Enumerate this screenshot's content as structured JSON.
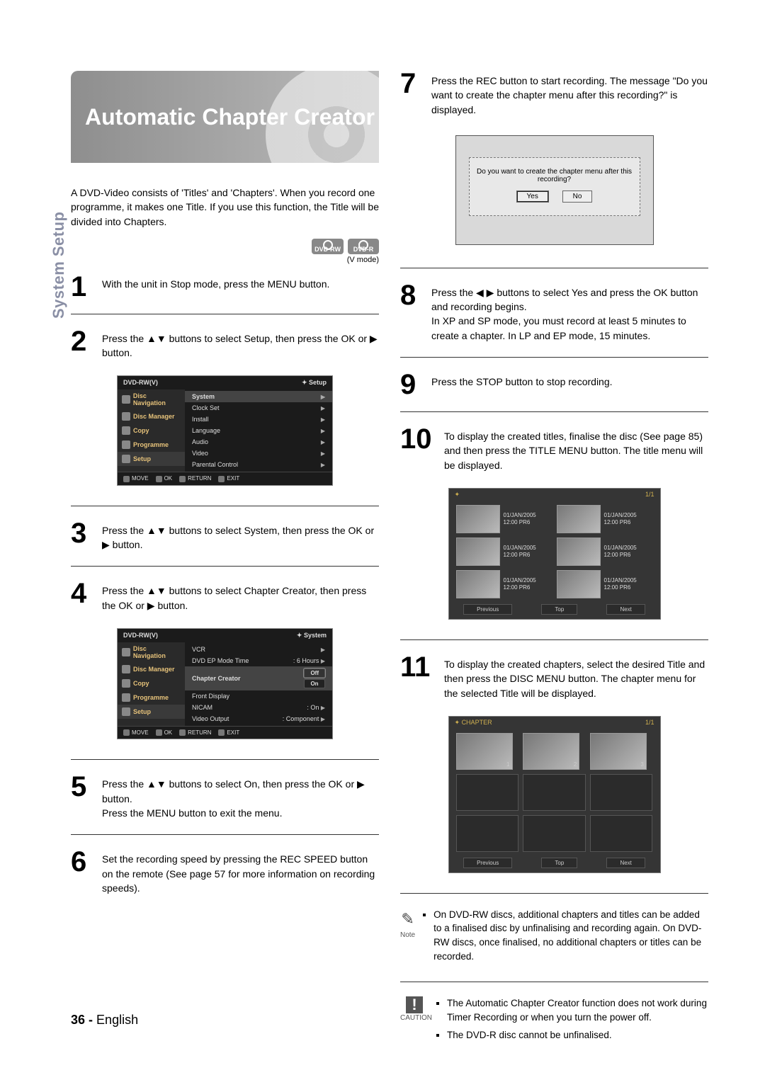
{
  "side_tab": "System Setup",
  "title": "Automatic Chapter Creator",
  "intro": "A DVD-Video consists of 'Titles' and 'Chapters'. When you record one programme, it makes one Title. If you use this function, the Title will be divided into Chapters.",
  "badges": {
    "rw": "DVD-RW",
    "r": "DVD-R",
    "vmode": "(V mode)"
  },
  "steps": {
    "s1": "With the unit in Stop mode, press the MENU button.",
    "s2": "Press the ▲▼ buttons to select Setup, then press the OK or ▶ button.",
    "s3": "Press the ▲▼ buttons to select System, then press the OK or ▶ button.",
    "s4": "Press the ▲▼ buttons to select Chapter Creator, then press the OK or ▶ button.",
    "s5": "Press the ▲▼ buttons to select On, then press the OK or ▶ button.\nPress the MENU button to exit the menu.",
    "s6": "Set the recording speed by pressing the REC SPEED button on the remote (See page 57 for more information on recording speeds).",
    "s7": "Press the REC button to start recording. The message \"Do you want to create the chapter menu after this recording?\" is displayed.",
    "s8": "Press the ◀ ▶ buttons to select Yes and press the OK button and recording begins.\nIn XP and SP mode, you must record at least 5 minutes to create a chapter. In LP and EP mode, 15 minutes.",
    "s9": "Press the STOP button to stop recording.",
    "s10": "To display the created titles, finalise the disc (See page 85) and then press the TITLE MENU button. The title menu will be displayed.",
    "s11": "To display the created chapters, select the desired Title and then press the DISC MENU button. The chapter menu for the selected Title will be displayed."
  },
  "osd1": {
    "hdr_l": "DVD-RW(V)",
    "hdr_r": "Setup",
    "nav": [
      "Disc Navigation",
      "Disc Manager",
      "Copy",
      "Programme",
      "Setup"
    ],
    "list": [
      "System",
      "Clock Set",
      "Install",
      "Language",
      "Audio",
      "Video",
      "Parental Control"
    ],
    "ftr": [
      "MOVE",
      "OK",
      "RETURN",
      "EXIT"
    ]
  },
  "osd2": {
    "hdr_l": "DVD-RW(V)",
    "hdr_r": "System",
    "nav": [
      "Disc Navigation",
      "Disc Manager",
      "Copy",
      "Programme",
      "Setup"
    ],
    "rows": [
      {
        "l": "VCR",
        "r": ""
      },
      {
        "l": "DVD EP Mode Time",
        "r": ": 6 Hours"
      },
      {
        "l": "Chapter Creator",
        "r": "",
        "opts": [
          "Off",
          "On"
        ]
      },
      {
        "l": "Front Display",
        "r": ""
      },
      {
        "l": "NICAM",
        "r": ": On"
      },
      {
        "l": "Video Output",
        "r": ": Component"
      }
    ],
    "ftr": [
      "MOVE",
      "OK",
      "RETURN",
      "EXIT"
    ]
  },
  "dialog": {
    "msg": "Do you want to create the chapter menu after this recording?",
    "yes": "Yes",
    "no": "No"
  },
  "title_menu": {
    "page": "1/1",
    "thumbs": [
      {
        "d": "01/JAN/2005",
        "t": "12:00  PR6"
      },
      {
        "d": "01/JAN/2005",
        "t": "12:00  PR6"
      },
      {
        "d": "01/JAN/2005",
        "t": "12:00  PR6"
      },
      {
        "d": "01/JAN/2005",
        "t": "12:00  PR6"
      },
      {
        "d": "01/JAN/2005",
        "t": "12:00  PR6"
      },
      {
        "d": "01/JAN/2005",
        "t": "12:00  PR6"
      }
    ],
    "btns": [
      "Previous",
      "Top",
      "Next"
    ]
  },
  "chapter_menu": {
    "label": "CHAPTER",
    "page": "1/1",
    "nums": [
      "1",
      "2",
      "3"
    ],
    "btns": [
      "Previous",
      "Top",
      "Next"
    ]
  },
  "note": {
    "label": "Note",
    "items": [
      "On DVD-RW discs, additional chapters and titles can be added to a finalised disc by unfinalising and recording again. On DVD-RW discs, once finalised, no additional chapters or titles can be recorded."
    ]
  },
  "caution": {
    "label": "CAUTION",
    "items": [
      "The Automatic Chapter Creator function does not work during Timer Recording or when you turn the power off.",
      "The DVD-R disc cannot be unfinalised."
    ]
  },
  "footer": {
    "page": "36 -",
    "lang": "English"
  }
}
